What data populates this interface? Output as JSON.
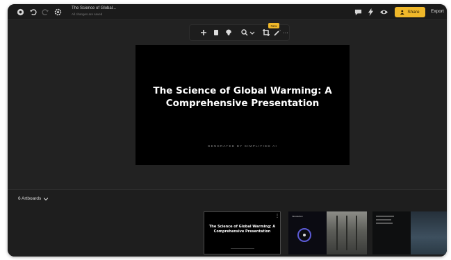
{
  "document": {
    "title": "The Science of Global...",
    "status": "All changes are saved"
  },
  "toolbar": {
    "tools": [
      "add-icon",
      "page-icon",
      "paint-icon",
      "zoom-icon",
      "crop-icon",
      "magic-icon",
      "more-icon"
    ],
    "new_badge": "New"
  },
  "topbar": {
    "share_label": "Share",
    "export_label": "Export"
  },
  "slide": {
    "title": "The Science of Global Warming: A Comprehensive Presentation",
    "subtitle": "GENERATED BY SIMPLIFIED AI"
  },
  "artboards": {
    "label": "6 Artboards",
    "thumbnails": [
      {
        "title": "The Science of Global Warming: A Comprehensive Presentation",
        "more": "⋮"
      },
      {
        "label": "Introduction"
      },
      {
        "label": ""
      }
    ]
  },
  "colors": {
    "accent": "#f0b82a",
    "frame_bg": "#222222",
    "slide_bg": "#000000"
  }
}
